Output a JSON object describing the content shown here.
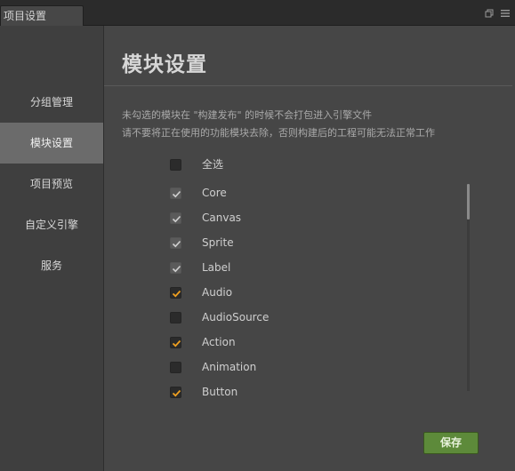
{
  "window": {
    "tab_title": "项目设置",
    "icons": [
      "restore-icon",
      "menu-icon"
    ]
  },
  "sidebar": {
    "items": [
      {
        "label": "分组管理",
        "active": false
      },
      {
        "label": "模块设置",
        "active": true
      },
      {
        "label": "项目预览",
        "active": false
      },
      {
        "label": "自定义引擎",
        "active": false
      },
      {
        "label": "服务",
        "active": false
      }
    ]
  },
  "main": {
    "title": "模块设置",
    "note_line1": "未勾选的模块在 \"构建发布\" 的时候不会打包进入引擎文件",
    "note_line2": "请不要将正在使用的功能模块去除，否则构建后的工程可能无法正常工作",
    "select_all": {
      "label": "全选",
      "checked": false
    },
    "modules": [
      {
        "label": "Core",
        "checked": true,
        "disabled": true
      },
      {
        "label": "Canvas",
        "checked": true,
        "disabled": true
      },
      {
        "label": "Sprite",
        "checked": true,
        "disabled": true
      },
      {
        "label": "Label",
        "checked": true,
        "disabled": true
      },
      {
        "label": "Audio",
        "checked": true,
        "disabled": false
      },
      {
        "label": "AudioSource",
        "checked": false,
        "disabled": false
      },
      {
        "label": "Action",
        "checked": true,
        "disabled": false
      },
      {
        "label": "Animation",
        "checked": false,
        "disabled": false
      },
      {
        "label": "Button",
        "checked": true,
        "disabled": false
      }
    ],
    "save_label": "保存"
  },
  "colors": {
    "accent_check": "#f0a020",
    "disabled_check": "#cfcfcf",
    "save_button": "#5d8a3a"
  }
}
